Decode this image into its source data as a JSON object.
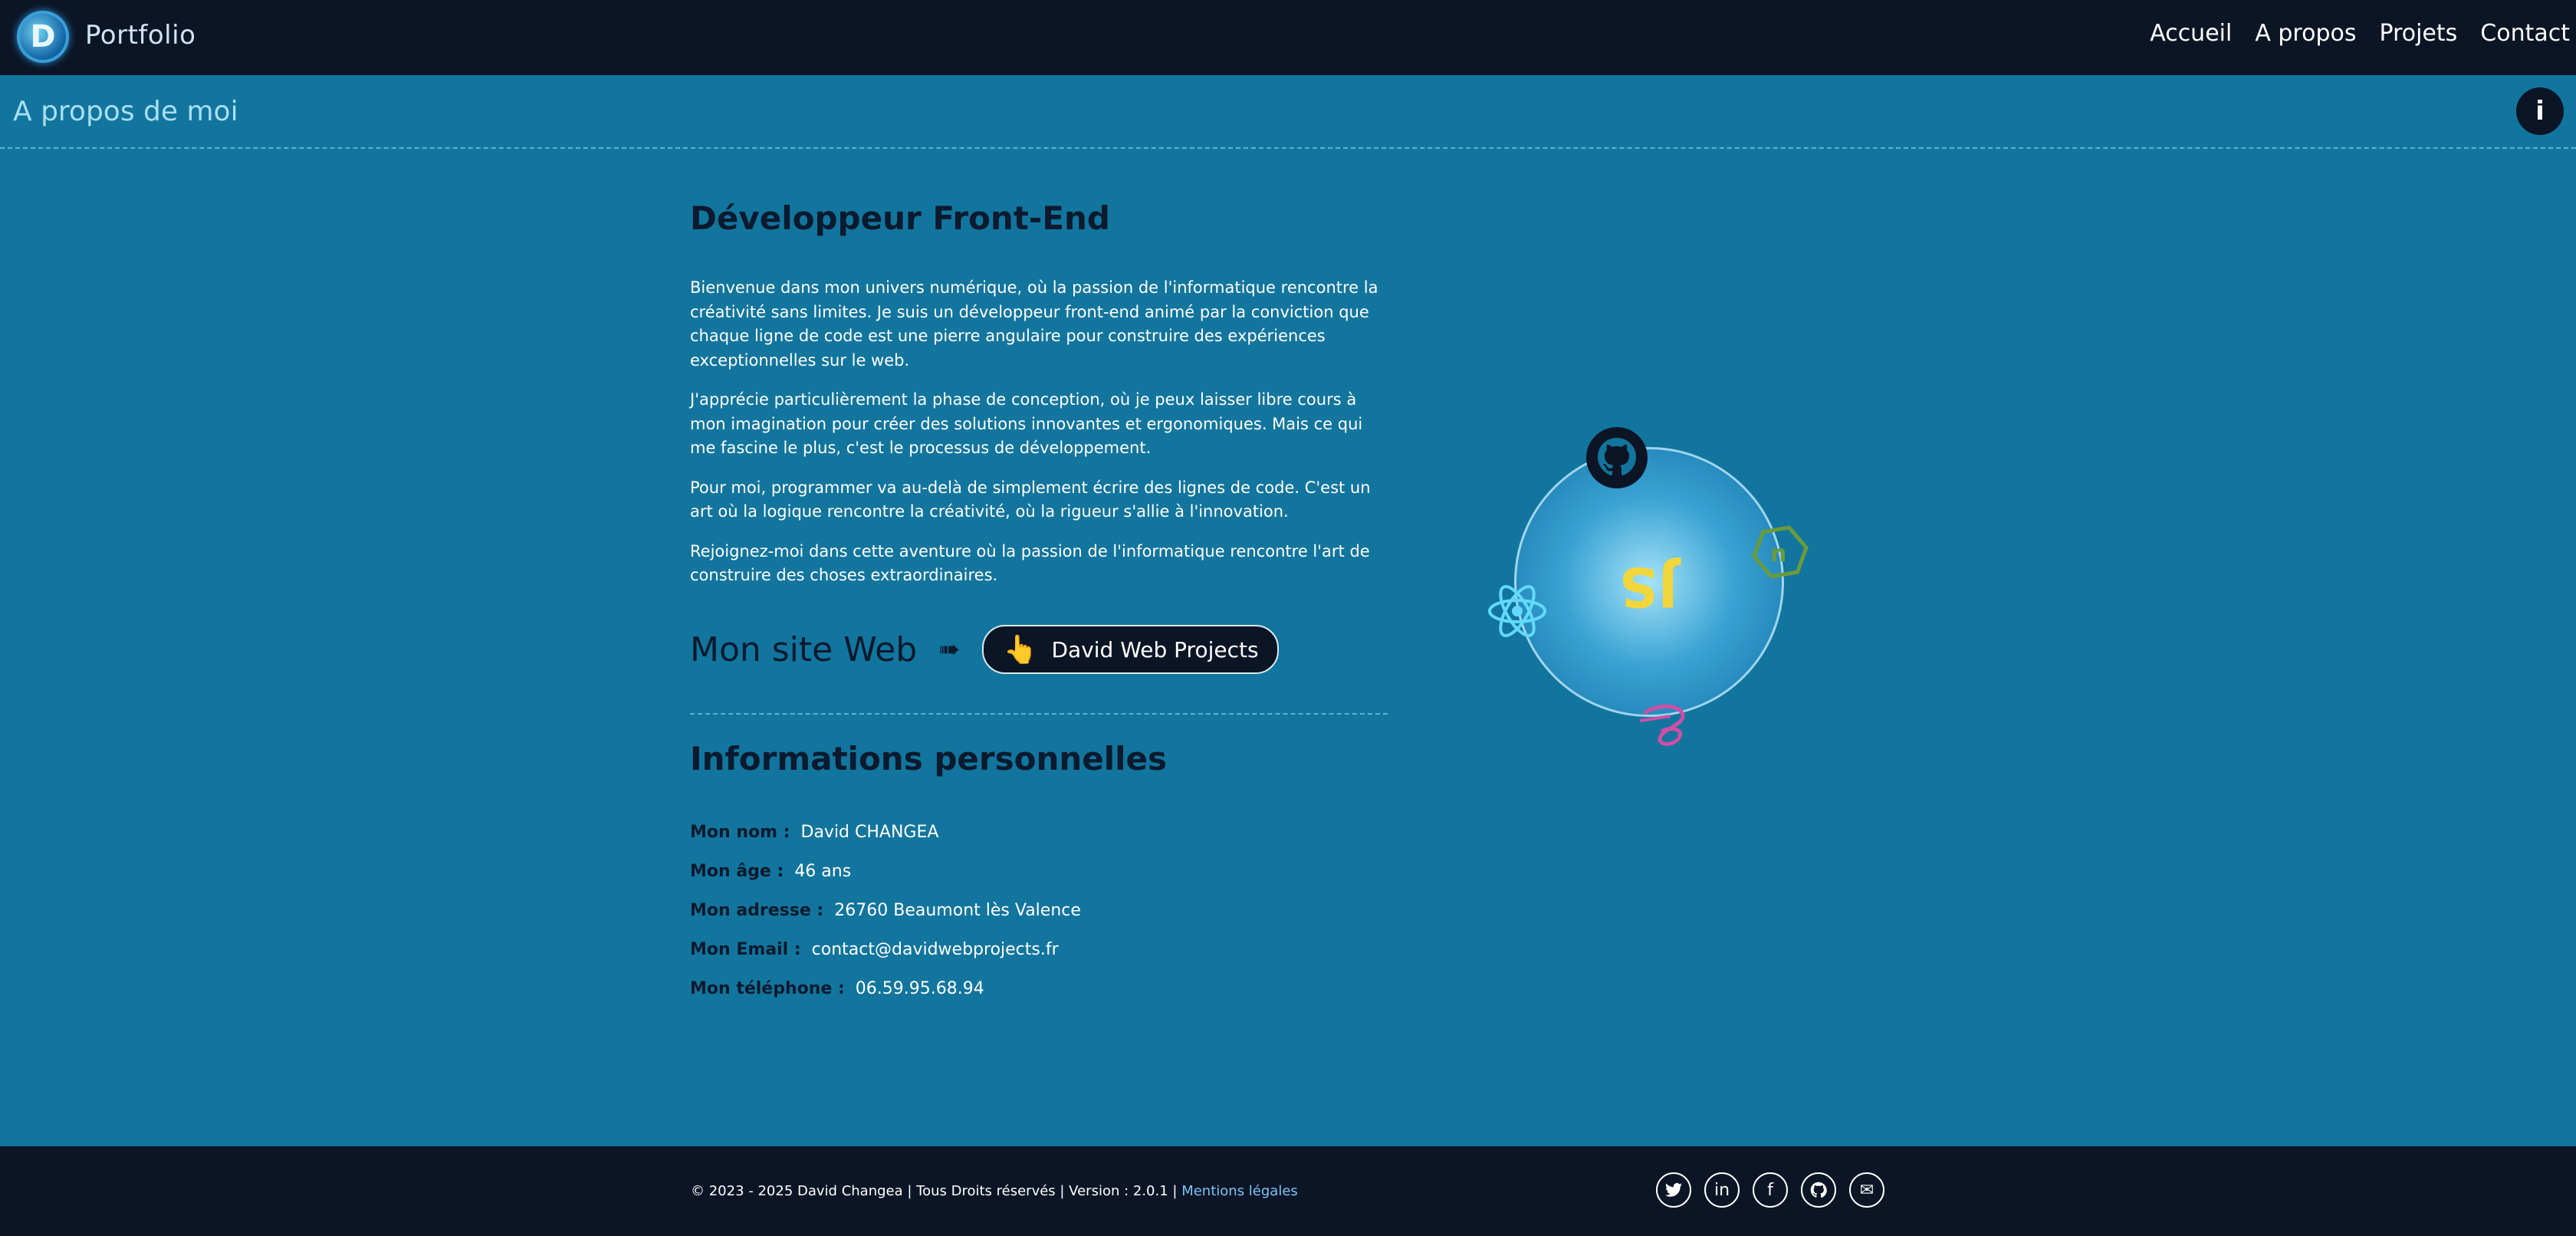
{
  "header": {
    "brand": "Portfolio",
    "logo_letter": "D",
    "nav": [
      {
        "label": "Accueil"
      },
      {
        "label": "A propos"
      },
      {
        "label": "Projets"
      },
      {
        "label": "Contact"
      }
    ]
  },
  "subheader": {
    "title": "A propos de moi",
    "info_icon": "info-icon",
    "info_glyph": "i"
  },
  "main": {
    "title": "Développeur Front-End",
    "paragraphs": [
      "Bienvenue dans mon univers numérique, où la passion de l'informatique rencontre la créativité sans limites. Je suis un développeur front-end animé par la conviction que chaque ligne de code est une pierre angulaire pour construire des expériences exceptionnelles sur le web.",
      "J'apprécie particulièrement la phase de conception, où je peux laisser libre cours à mon imagination pour créer des solutions innovantes et ergonomiques. Mais ce qui me fascine le plus, c'est le processus de développement.",
      "Pour moi, programmer va au-delà de simplement écrire des lignes de code. C'est un art où la logique rencontre la créativité, où la rigueur s'allie à l'innovation.",
      "Rejoignez-moi dans cette aventure où la passion de l'informatique rencontre l'art de construire des choses extraordinaires."
    ],
    "website": {
      "title": "Mon site Web",
      "arrow": "➠",
      "button_label": "David Web Projects",
      "hand": "👆"
    },
    "info_title": "Informations personnelles",
    "info": [
      {
        "label": "Mon nom :",
        "value": "David CHANGEA"
      },
      {
        "label": "Mon âge :",
        "value": "46 ans"
      },
      {
        "label": "Mon adresse :",
        "value": "26760 Beaumont lès Valence"
      },
      {
        "label": "Mon Email :",
        "value": "contact@davidwebprojects.fr"
      },
      {
        "label": "Mon téléphone :",
        "value": "06.59.95.68.94"
      }
    ]
  },
  "orbit": {
    "center_text": "JS",
    "icons": [
      "github-icon",
      "react-icon",
      "nodejs-icon",
      "sass-icon"
    ],
    "colors": {
      "js": "#f2d63b",
      "react": "#61dafb",
      "node": "#6a9a3c",
      "sass": "#cd4fa6",
      "github": "#0b1525"
    }
  },
  "footer": {
    "copyright": "© 2023 - 2025 David Changea | Tous Droits réservés | Version : 2.0.1 |",
    "legal_link": "Mentions légales",
    "socials": [
      {
        "icon": "twitter-icon"
      },
      {
        "icon": "linkedin-icon",
        "glyph": "in"
      },
      {
        "icon": "facebook-icon",
        "glyph": "f"
      },
      {
        "icon": "github-icon"
      },
      {
        "icon": "mail-icon",
        "glyph": "✉"
      }
    ]
  },
  "colors": {
    "background": "#12759d",
    "dark": "#0b1525",
    "heading": "#0b1a2e",
    "accent_link": "#7ac4f6"
  }
}
